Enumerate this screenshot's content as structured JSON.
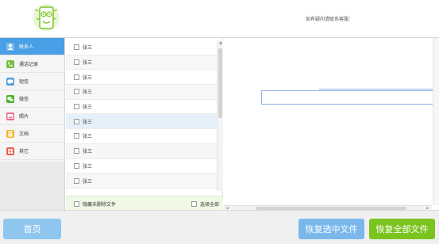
{
  "header": {
    "contact_text": "如有疑问请联系客服："
  },
  "sidebar": {
    "items": [
      {
        "label": "联系人",
        "icon": "contact-icon",
        "color": "#5ea8e6",
        "active": true
      },
      {
        "label": "通话记录",
        "icon": "phone-icon",
        "color": "#75c044",
        "active": false
      },
      {
        "label": "短信",
        "icon": "sms-icon",
        "color": "#4a9fe0",
        "active": false
      },
      {
        "label": "微信",
        "icon": "wechat-icon",
        "color": "#4cb12a",
        "active": false
      },
      {
        "label": "照片",
        "icon": "photo-icon",
        "color": "#f06b8a",
        "active": false
      },
      {
        "label": "文档",
        "icon": "document-icon",
        "color": "#f5b325",
        "active": false
      },
      {
        "label": "其它",
        "icon": "other-icon",
        "color": "#ef5f4b",
        "active": false
      }
    ]
  },
  "list": {
    "rows": [
      "张三",
      "张三",
      "张三",
      "张三",
      "张三",
      "张三",
      "张三",
      "张三",
      "张三",
      "张三"
    ],
    "footer_left": "隐藏未删除文件",
    "footer_right": "选择全部"
  },
  "footer": {
    "home_label": "首页",
    "restore_selected_label": "恢复选中文件",
    "restore_all_label": "恢复全部文件"
  },
  "colors": {
    "accent_blue": "#4aa0e6",
    "accent_green": "#7bc41f"
  }
}
